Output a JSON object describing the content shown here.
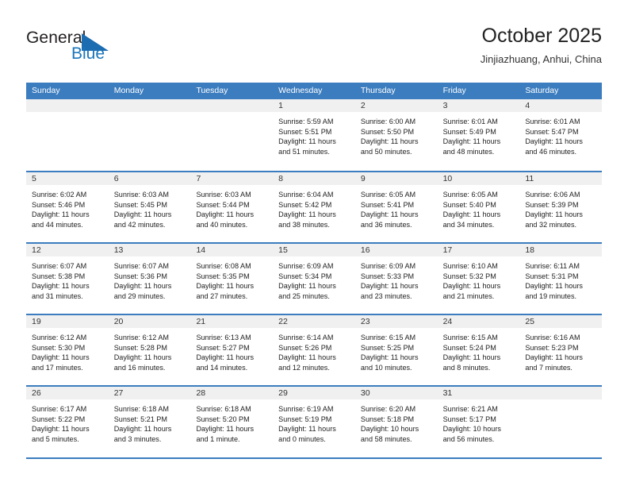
{
  "logo": {
    "word_one": "General",
    "word_two": "Blue",
    "triangle_color": "#1b6cb0",
    "blue_color": "#1b75bb"
  },
  "header": {
    "title": "October 2025",
    "subtitle": "Jinjiazhuang, Anhui, China",
    "accent_color": "#3c7dbf"
  },
  "weekdays": [
    "Sunday",
    "Monday",
    "Tuesday",
    "Wednesday",
    "Thursday",
    "Friday",
    "Saturday"
  ],
  "weeks": [
    [
      {
        "day": "",
        "sunrise": "",
        "sunset": "",
        "daylight_a": "",
        "daylight_b": ""
      },
      {
        "day": "",
        "sunrise": "",
        "sunset": "",
        "daylight_a": "",
        "daylight_b": ""
      },
      {
        "day": "",
        "sunrise": "",
        "sunset": "",
        "daylight_a": "",
        "daylight_b": ""
      },
      {
        "day": "1",
        "sunrise": "Sunrise: 5:59 AM",
        "sunset": "Sunset: 5:51 PM",
        "daylight_a": "Daylight: 11 hours",
        "daylight_b": "and 51 minutes."
      },
      {
        "day": "2",
        "sunrise": "Sunrise: 6:00 AM",
        "sunset": "Sunset: 5:50 PM",
        "daylight_a": "Daylight: 11 hours",
        "daylight_b": "and 50 minutes."
      },
      {
        "day": "3",
        "sunrise": "Sunrise: 6:01 AM",
        "sunset": "Sunset: 5:49 PM",
        "daylight_a": "Daylight: 11 hours",
        "daylight_b": "and 48 minutes."
      },
      {
        "day": "4",
        "sunrise": "Sunrise: 6:01 AM",
        "sunset": "Sunset: 5:47 PM",
        "daylight_a": "Daylight: 11 hours",
        "daylight_b": "and 46 minutes."
      }
    ],
    [
      {
        "day": "5",
        "sunrise": "Sunrise: 6:02 AM",
        "sunset": "Sunset: 5:46 PM",
        "daylight_a": "Daylight: 11 hours",
        "daylight_b": "and 44 minutes."
      },
      {
        "day": "6",
        "sunrise": "Sunrise: 6:03 AM",
        "sunset": "Sunset: 5:45 PM",
        "daylight_a": "Daylight: 11 hours",
        "daylight_b": "and 42 minutes."
      },
      {
        "day": "7",
        "sunrise": "Sunrise: 6:03 AM",
        "sunset": "Sunset: 5:44 PM",
        "daylight_a": "Daylight: 11 hours",
        "daylight_b": "and 40 minutes."
      },
      {
        "day": "8",
        "sunrise": "Sunrise: 6:04 AM",
        "sunset": "Sunset: 5:42 PM",
        "daylight_a": "Daylight: 11 hours",
        "daylight_b": "and 38 minutes."
      },
      {
        "day": "9",
        "sunrise": "Sunrise: 6:05 AM",
        "sunset": "Sunset: 5:41 PM",
        "daylight_a": "Daylight: 11 hours",
        "daylight_b": "and 36 minutes."
      },
      {
        "day": "10",
        "sunrise": "Sunrise: 6:05 AM",
        "sunset": "Sunset: 5:40 PM",
        "daylight_a": "Daylight: 11 hours",
        "daylight_b": "and 34 minutes."
      },
      {
        "day": "11",
        "sunrise": "Sunrise: 6:06 AM",
        "sunset": "Sunset: 5:39 PM",
        "daylight_a": "Daylight: 11 hours",
        "daylight_b": "and 32 minutes."
      }
    ],
    [
      {
        "day": "12",
        "sunrise": "Sunrise: 6:07 AM",
        "sunset": "Sunset: 5:38 PM",
        "daylight_a": "Daylight: 11 hours",
        "daylight_b": "and 31 minutes."
      },
      {
        "day": "13",
        "sunrise": "Sunrise: 6:07 AM",
        "sunset": "Sunset: 5:36 PM",
        "daylight_a": "Daylight: 11 hours",
        "daylight_b": "and 29 minutes."
      },
      {
        "day": "14",
        "sunrise": "Sunrise: 6:08 AM",
        "sunset": "Sunset: 5:35 PM",
        "daylight_a": "Daylight: 11 hours",
        "daylight_b": "and 27 minutes."
      },
      {
        "day": "15",
        "sunrise": "Sunrise: 6:09 AM",
        "sunset": "Sunset: 5:34 PM",
        "daylight_a": "Daylight: 11 hours",
        "daylight_b": "and 25 minutes."
      },
      {
        "day": "16",
        "sunrise": "Sunrise: 6:09 AM",
        "sunset": "Sunset: 5:33 PM",
        "daylight_a": "Daylight: 11 hours",
        "daylight_b": "and 23 minutes."
      },
      {
        "day": "17",
        "sunrise": "Sunrise: 6:10 AM",
        "sunset": "Sunset: 5:32 PM",
        "daylight_a": "Daylight: 11 hours",
        "daylight_b": "and 21 minutes."
      },
      {
        "day": "18",
        "sunrise": "Sunrise: 6:11 AM",
        "sunset": "Sunset: 5:31 PM",
        "daylight_a": "Daylight: 11 hours",
        "daylight_b": "and 19 minutes."
      }
    ],
    [
      {
        "day": "19",
        "sunrise": "Sunrise: 6:12 AM",
        "sunset": "Sunset: 5:30 PM",
        "daylight_a": "Daylight: 11 hours",
        "daylight_b": "and 17 minutes."
      },
      {
        "day": "20",
        "sunrise": "Sunrise: 6:12 AM",
        "sunset": "Sunset: 5:28 PM",
        "daylight_a": "Daylight: 11 hours",
        "daylight_b": "and 16 minutes."
      },
      {
        "day": "21",
        "sunrise": "Sunrise: 6:13 AM",
        "sunset": "Sunset: 5:27 PM",
        "daylight_a": "Daylight: 11 hours",
        "daylight_b": "and 14 minutes."
      },
      {
        "day": "22",
        "sunrise": "Sunrise: 6:14 AM",
        "sunset": "Sunset: 5:26 PM",
        "daylight_a": "Daylight: 11 hours",
        "daylight_b": "and 12 minutes."
      },
      {
        "day": "23",
        "sunrise": "Sunrise: 6:15 AM",
        "sunset": "Sunset: 5:25 PM",
        "daylight_a": "Daylight: 11 hours",
        "daylight_b": "and 10 minutes."
      },
      {
        "day": "24",
        "sunrise": "Sunrise: 6:15 AM",
        "sunset": "Sunset: 5:24 PM",
        "daylight_a": "Daylight: 11 hours",
        "daylight_b": "and 8 minutes."
      },
      {
        "day": "25",
        "sunrise": "Sunrise: 6:16 AM",
        "sunset": "Sunset: 5:23 PM",
        "daylight_a": "Daylight: 11 hours",
        "daylight_b": "and 7 minutes."
      }
    ],
    [
      {
        "day": "26",
        "sunrise": "Sunrise: 6:17 AM",
        "sunset": "Sunset: 5:22 PM",
        "daylight_a": "Daylight: 11 hours",
        "daylight_b": "and 5 minutes."
      },
      {
        "day": "27",
        "sunrise": "Sunrise: 6:18 AM",
        "sunset": "Sunset: 5:21 PM",
        "daylight_a": "Daylight: 11 hours",
        "daylight_b": "and 3 minutes."
      },
      {
        "day": "28",
        "sunrise": "Sunrise: 6:18 AM",
        "sunset": "Sunset: 5:20 PM",
        "daylight_a": "Daylight: 11 hours",
        "daylight_b": "and 1 minute."
      },
      {
        "day": "29",
        "sunrise": "Sunrise: 6:19 AM",
        "sunset": "Sunset: 5:19 PM",
        "daylight_a": "Daylight: 11 hours",
        "daylight_b": "and 0 minutes."
      },
      {
        "day": "30",
        "sunrise": "Sunrise: 6:20 AM",
        "sunset": "Sunset: 5:18 PM",
        "daylight_a": "Daylight: 10 hours",
        "daylight_b": "and 58 minutes."
      },
      {
        "day": "31",
        "sunrise": "Sunrise: 6:21 AM",
        "sunset": "Sunset: 5:17 PM",
        "daylight_a": "Daylight: 10 hours",
        "daylight_b": "and 56 minutes."
      },
      {
        "day": "",
        "sunrise": "",
        "sunset": "",
        "daylight_a": "",
        "daylight_b": ""
      }
    ]
  ]
}
